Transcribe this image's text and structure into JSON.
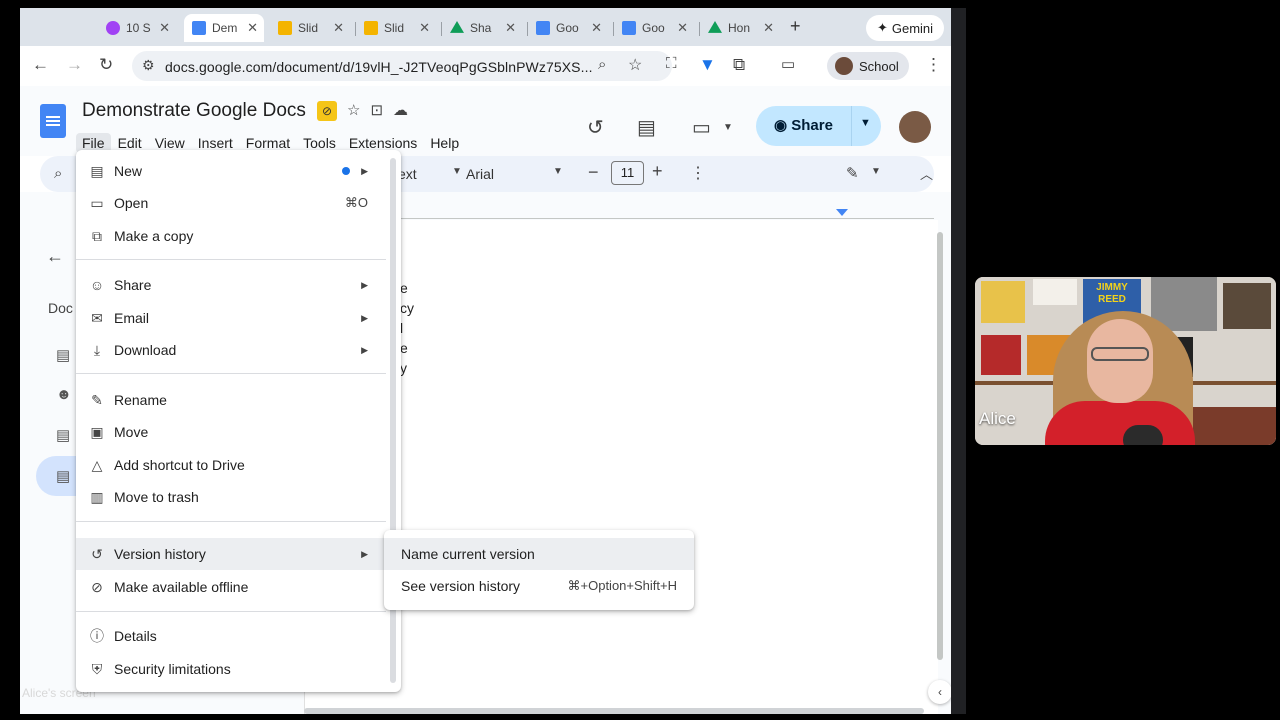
{
  "browser": {
    "tabs": [
      {
        "label": "10 S",
        "color": "#a142f4"
      },
      {
        "label": "Dem",
        "color": "#4285f4"
      },
      {
        "label": "Slid",
        "color": "#f4b400"
      },
      {
        "label": "Slid",
        "color": "#f4b400"
      },
      {
        "label": "Sha",
        "color": "#0f9d58"
      },
      {
        "label": "Goo",
        "color": "#4285f4"
      },
      {
        "label": "Goo",
        "color": "#4285f4"
      },
      {
        "label": "Hon",
        "color": "#0f9d58"
      }
    ],
    "gemini_label": "Gemini",
    "url": "docs.google.com/document/d/19vlH_-J2TVeoqPgGSblnPWz75XS...",
    "profile_label": "School"
  },
  "doc": {
    "title": "Demonstrate Google Docs",
    "menus": [
      "File",
      "Edit",
      "View",
      "Insert",
      "Format",
      "Tools",
      "Extensions",
      "Help"
    ],
    "share_label": "Share"
  },
  "toolbar": {
    "style_partial": "ext",
    "font": "Arial",
    "font_size": "11"
  },
  "outline": {
    "label_partial": "Doc"
  },
  "body_lines": [
    "e",
    "cy",
    "l",
    "e",
    "y"
  ],
  "file_menu": {
    "items": [
      {
        "icon": "▤",
        "label": "New",
        "submenu": true,
        "dot": true
      },
      {
        "icon": "▭",
        "label": "Open",
        "shortcut": "⌘O"
      },
      {
        "icon": "⧉",
        "label": "Make a copy"
      },
      {
        "icon": "⁺",
        "label": "Share",
        "submenu": true
      },
      {
        "icon": "✉",
        "label": "Email",
        "submenu": true
      },
      {
        "icon": "⤓",
        "label": "Download",
        "submenu": true
      },
      {
        "icon": "✎",
        "label": "Rename"
      },
      {
        "icon": "▣",
        "label": "Move"
      },
      {
        "icon": "△",
        "label": "Add shortcut to Drive"
      },
      {
        "icon": "🗑",
        "label": "Move to trash"
      },
      {
        "icon": "↺",
        "label": "Version history",
        "submenu": true
      },
      {
        "icon": "⊘",
        "label": "Make available offline"
      },
      {
        "icon": "ⓘ",
        "label": "Details"
      },
      {
        "icon": "⛨",
        "label": "Security limitations"
      }
    ]
  },
  "version_submenu": {
    "items": [
      {
        "label": "Name current version",
        "shortcut": ""
      },
      {
        "label": "See version history",
        "shortcut": "⌘+Option+Shift+H"
      }
    ]
  },
  "webcam": {
    "name": "Alice",
    "caption": "Alice's screen",
    "poster_text": "JIMMY REED"
  }
}
